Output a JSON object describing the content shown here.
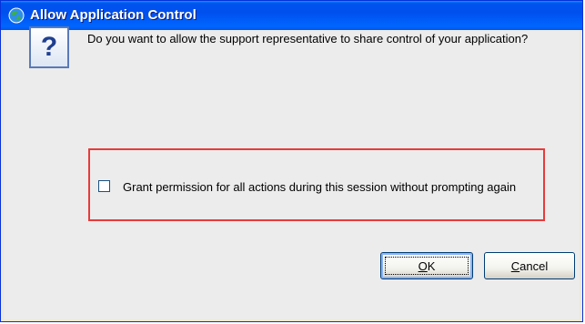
{
  "window": {
    "title": "Allow Application Control",
    "title_icon": "globe-icon"
  },
  "dialog": {
    "icon": "question-icon",
    "icon_glyph": "?",
    "question": "Do you want to allow the support representative to share control of your application?",
    "checkbox": {
      "label": "Grant permission for all actions during this session without prompting again",
      "checked": false
    },
    "highlight_color": "#e83a3a"
  },
  "buttons": {
    "ok": {
      "mnemonic": "O",
      "rest": "K"
    },
    "cancel": {
      "mnemonic": "C",
      "rest": "ancel"
    }
  },
  "colors": {
    "titlebar": "#0055ea",
    "dialog_bg": "#ececec"
  }
}
